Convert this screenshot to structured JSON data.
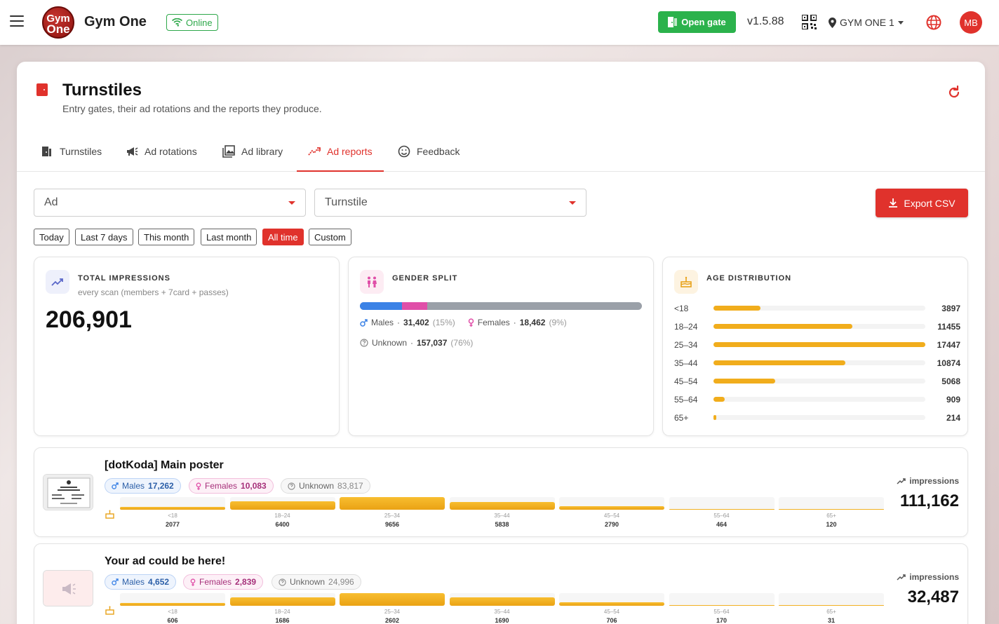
{
  "topbar": {
    "logo_line1": "Gym",
    "logo_line2": "One",
    "app_name": "Gym One",
    "status": "Online",
    "open_gate": "Open gate",
    "version": "v1.5.88",
    "location": "GYM ONE 1",
    "avatar": "MB"
  },
  "page": {
    "title": "Turnstiles",
    "subtitle": "Entry gates, their ad rotations and the reports they produce."
  },
  "tabs": [
    {
      "label": "Turnstiles",
      "icon": "turnstile-icon"
    },
    {
      "label": "Ad rotations",
      "icon": "megaphone-icon"
    },
    {
      "label": "Ad library",
      "icon": "image-library-icon"
    },
    {
      "label": "Ad reports",
      "icon": "trending-chart-icon",
      "active": true
    },
    {
      "label": "Feedback",
      "icon": "smiley-icon"
    }
  ],
  "filters": {
    "ad_placeholder": "Ad",
    "turnstile_placeholder": "Turnstile",
    "export": "Export CSV",
    "ranges": [
      "Today",
      "Last 7 days",
      "This month",
      "Last month",
      "All time",
      "Custom"
    ],
    "active_range": "All time"
  },
  "total": {
    "label": "TOTAL IMPRESSIONS",
    "sub": "every scan (members + 7card + passes)",
    "value": "206,901"
  },
  "gender": {
    "label": "GENDER SPLIT",
    "males_label": "Males",
    "males_value": "31,402",
    "males_pct": "(15%)",
    "females_label": "Females",
    "females_value": "18,462",
    "females_pct": "(9%)",
    "unknown_label": "Unknown",
    "unknown_value": "157,037",
    "unknown_pct": "(76%)",
    "male_share": 15,
    "female_share": 9
  },
  "age": {
    "label": "AGE DISTRIBUTION",
    "rows": [
      {
        "label": "<18",
        "value": "3897",
        "n": 3897
      },
      {
        "label": "18–24",
        "value": "11455",
        "n": 11455
      },
      {
        "label": "25–34",
        "value": "17447",
        "n": 17447
      },
      {
        "label": "35–44",
        "value": "10874",
        "n": 10874
      },
      {
        "label": "45–54",
        "value": "5068",
        "n": 5068
      },
      {
        "label": "55–64",
        "value": "909",
        "n": 909
      },
      {
        "label": "65+",
        "value": "214",
        "n": 214
      }
    ]
  },
  "ads": [
    {
      "title": "[dotKoda] Main poster",
      "males_label": "Males",
      "males": "17,262",
      "females_label": "Females",
      "females": "10,083",
      "unknown_label": "Unknown",
      "unknown": "83,817",
      "impressions_label": "impressions",
      "impressions": "111,162",
      "ages": [
        {
          "label": "<18",
          "value": "2077",
          "n": 2077
        },
        {
          "label": "18–24",
          "value": "6400",
          "n": 6400
        },
        {
          "label": "25–34",
          "value": "9656",
          "n": 9656
        },
        {
          "label": "35–44",
          "value": "5838",
          "n": 5838
        },
        {
          "label": "45–54",
          "value": "2790",
          "n": 2790
        },
        {
          "label": "55–64",
          "value": "464",
          "n": 464
        },
        {
          "label": "65+",
          "value": "120",
          "n": 120
        }
      ]
    },
    {
      "title": "Your ad could be here!",
      "males_label": "Males",
      "males": "4,652",
      "females_label": "Females",
      "females": "2,839",
      "unknown_label": "Unknown",
      "unknown": "24,996",
      "impressions_label": "impressions",
      "impressions": "32,487",
      "ages": [
        {
          "label": "<18",
          "value": "606",
          "n": 606
        },
        {
          "label": "18–24",
          "value": "1686",
          "n": 1686
        },
        {
          "label": "25–34",
          "value": "2602",
          "n": 2602
        },
        {
          "label": "35–44",
          "value": "1690",
          "n": 1690
        },
        {
          "label": "45–54",
          "value": "706",
          "n": 706
        },
        {
          "label": "55–64",
          "value": "170",
          "n": 170
        },
        {
          "label": "65+",
          "value": "31",
          "n": 31
        }
      ]
    }
  ],
  "colors": {
    "accent": "#e0322c",
    "success": "#2bb24c",
    "male": "#3b82e6",
    "female": "#e04fa8",
    "unknown": "#9aa0a8",
    "age_bar": "#f1ad1c"
  }
}
